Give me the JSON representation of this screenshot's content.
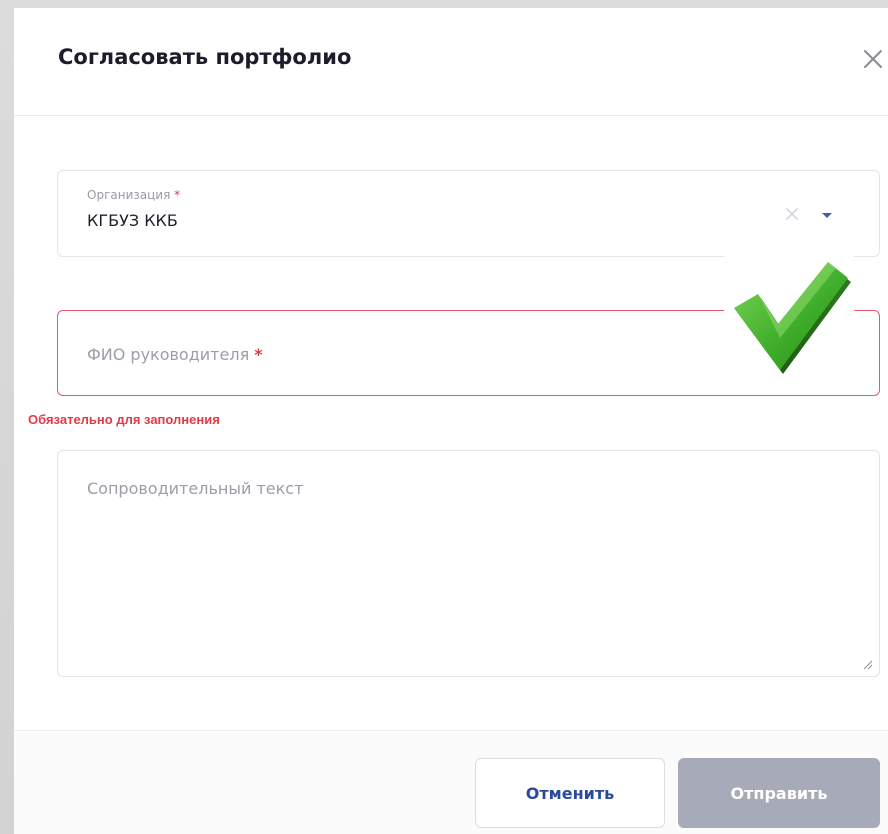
{
  "dialog": {
    "title": "Согласовать портфолио"
  },
  "form": {
    "organization": {
      "label": "Организация",
      "required_mark": "*",
      "value": "КГБУЗ ККБ"
    },
    "manager_name": {
      "placeholder": "ФИО руководителя",
      "required_mark": "*",
      "error": "Обязательно для заполнения"
    },
    "cover_text": {
      "placeholder": "Сопроводительный текст"
    }
  },
  "footer": {
    "cancel_label": "Отменить",
    "submit_label": "Отправить"
  },
  "icons": {
    "close": "close-icon",
    "clear": "clear-icon",
    "dropdown": "chevron-down-icon",
    "resize": "resize-handle-icon",
    "overlay": "checkmark-icon"
  },
  "colors": {
    "error": "#e03a47",
    "accent": "#2c4a9c",
    "submit_disabled": "#a7aab9",
    "checkmark": "#3fae2a"
  }
}
